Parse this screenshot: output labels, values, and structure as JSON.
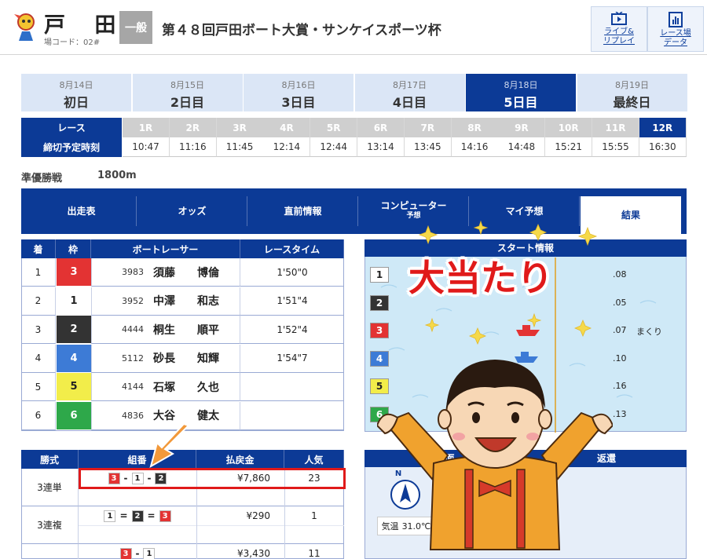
{
  "header": {
    "venue": "戸 田",
    "venue_code": "場コード：02#",
    "grade": "一般",
    "race_title": "第４８回戸田ボート大賞・サンケイスポーツ杯",
    "live_label_1": "ライブ&",
    "live_label_2": "リプレイ",
    "data_label_1": "レース場",
    "data_label_2": "データ"
  },
  "days": [
    {
      "date": "8月14日",
      "name": "初日"
    },
    {
      "date": "8月15日",
      "name": "2日目"
    },
    {
      "date": "8月16日",
      "name": "3日目"
    },
    {
      "date": "8月17日",
      "name": "4日目"
    },
    {
      "date": "8月18日",
      "name": "5日目"
    },
    {
      "date": "8月19日",
      "name": "最終日"
    }
  ],
  "race_grid": {
    "race_label": "レース",
    "time_label": "締切予定時刻",
    "races": [
      "1R",
      "2R",
      "3R",
      "4R",
      "5R",
      "6R",
      "7R",
      "8R",
      "9R",
      "10R",
      "11R",
      "12R"
    ],
    "times": [
      "10:47",
      "11:16",
      "11:45",
      "12:14",
      "12:44",
      "13:14",
      "13:45",
      "14:16",
      "14:48",
      "15:21",
      "15:55",
      "16:30"
    ]
  },
  "race_info": {
    "stage": "準優勝戦",
    "distance": "1800m"
  },
  "nav": [
    {
      "label": "出走表"
    },
    {
      "label": "オッズ"
    },
    {
      "label": "直前情報"
    },
    {
      "label": "コンピューター",
      "sub": "予想"
    },
    {
      "label": "マイ予想"
    },
    {
      "label": "結果"
    }
  ],
  "results": {
    "headers": [
      "着",
      "枠",
      "ボートレーサー",
      "レースタイム"
    ],
    "rows": [
      {
        "place": "1",
        "frame": "3",
        "id": "3983",
        "name": "須藤　　博倫",
        "time": "1'50\"0"
      },
      {
        "place": "2",
        "frame": "1",
        "id": "3952",
        "name": "中澤　　和志",
        "time": "1'51\"4"
      },
      {
        "place": "3",
        "frame": "2",
        "id": "4444",
        "name": "桐生　　順平",
        "time": "1'52\"4"
      },
      {
        "place": "4",
        "frame": "4",
        "id": "5112",
        "name": "砂長　　知輝",
        "time": "1'54\"7"
      },
      {
        "place": "5",
        "frame": "5",
        "id": "4144",
        "name": "石塚　　久也",
        "time": ""
      },
      {
        "place": "6",
        "frame": "6",
        "id": "4836",
        "name": "大谷　　健太",
        "time": ""
      }
    ]
  },
  "start_info": {
    "title": "スタート情報",
    "lanes": [
      {
        "lane": "1",
        "st": ".08",
        "note": ""
      },
      {
        "lane": "2",
        "st": ".05",
        "note": ""
      },
      {
        "lane": "3",
        "st": ".07",
        "note": "まくり"
      },
      {
        "lane": "4",
        "st": ".10",
        "note": ""
      },
      {
        "lane": "5",
        "st": ".16",
        "note": ""
      },
      {
        "lane": "6",
        "st": ".13",
        "note": ""
      }
    ]
  },
  "payout": {
    "headers": [
      "勝式",
      "組番",
      "払戻金",
      "人気"
    ],
    "rows": [
      {
        "type": "3連単",
        "combo": [
          "3",
          "1",
          "2"
        ],
        "seps": [
          "-",
          "-"
        ],
        "amount": "¥7,860",
        "pop": "23"
      },
      {
        "type": "3連複",
        "combo": [
          "1",
          "2",
          "3"
        ],
        "seps": [
          "=",
          "="
        ],
        "amount": "¥290",
        "pop": "1"
      },
      {
        "type": "",
        "combo": [
          "3",
          "1"
        ],
        "seps": [
          "-"
        ],
        "amount": "¥3,430",
        "pop": "11"
      }
    ]
  },
  "weather": {
    "title_left": "水面",
    "title_right": "返還",
    "compass": "N",
    "temp_label": "気温",
    "temp_value": "31.0℃"
  },
  "overlay": {
    "text": "大当たり"
  },
  "colors": {
    "brand": "#0c3a96",
    "highlight": "#e01a1a",
    "overlay_text": "#e01a1a"
  }
}
